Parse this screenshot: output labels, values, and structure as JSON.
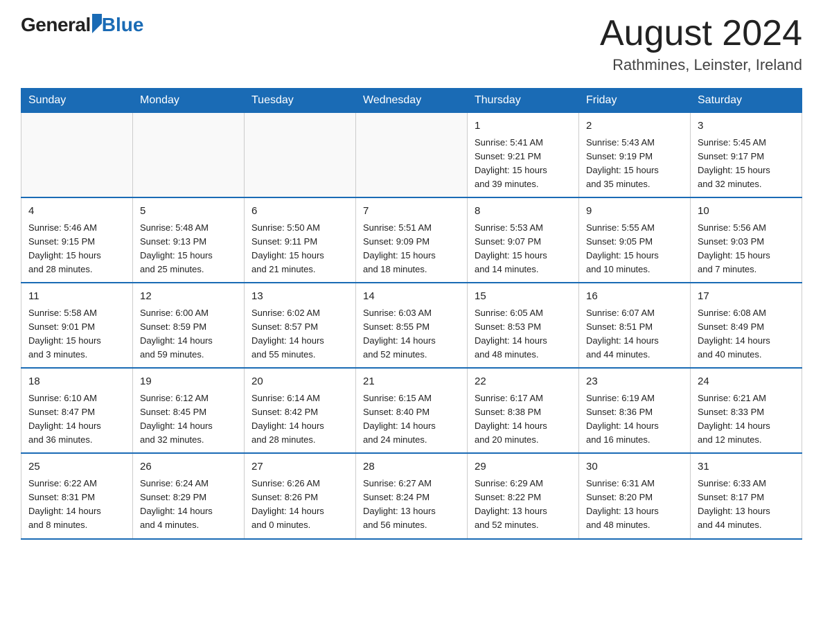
{
  "header": {
    "logo_general": "General",
    "logo_blue": "Blue",
    "month_title": "August 2024",
    "location": "Rathmines, Leinster, Ireland"
  },
  "days_of_week": [
    "Sunday",
    "Monday",
    "Tuesday",
    "Wednesday",
    "Thursday",
    "Friday",
    "Saturday"
  ],
  "weeks": [
    [
      {
        "day": "",
        "info": ""
      },
      {
        "day": "",
        "info": ""
      },
      {
        "day": "",
        "info": ""
      },
      {
        "day": "",
        "info": ""
      },
      {
        "day": "1",
        "info": "Sunrise: 5:41 AM\nSunset: 9:21 PM\nDaylight: 15 hours\nand 39 minutes."
      },
      {
        "day": "2",
        "info": "Sunrise: 5:43 AM\nSunset: 9:19 PM\nDaylight: 15 hours\nand 35 minutes."
      },
      {
        "day": "3",
        "info": "Sunrise: 5:45 AM\nSunset: 9:17 PM\nDaylight: 15 hours\nand 32 minutes."
      }
    ],
    [
      {
        "day": "4",
        "info": "Sunrise: 5:46 AM\nSunset: 9:15 PM\nDaylight: 15 hours\nand 28 minutes."
      },
      {
        "day": "5",
        "info": "Sunrise: 5:48 AM\nSunset: 9:13 PM\nDaylight: 15 hours\nand 25 minutes."
      },
      {
        "day": "6",
        "info": "Sunrise: 5:50 AM\nSunset: 9:11 PM\nDaylight: 15 hours\nand 21 minutes."
      },
      {
        "day": "7",
        "info": "Sunrise: 5:51 AM\nSunset: 9:09 PM\nDaylight: 15 hours\nand 18 minutes."
      },
      {
        "day": "8",
        "info": "Sunrise: 5:53 AM\nSunset: 9:07 PM\nDaylight: 15 hours\nand 14 minutes."
      },
      {
        "day": "9",
        "info": "Sunrise: 5:55 AM\nSunset: 9:05 PM\nDaylight: 15 hours\nand 10 minutes."
      },
      {
        "day": "10",
        "info": "Sunrise: 5:56 AM\nSunset: 9:03 PM\nDaylight: 15 hours\nand 7 minutes."
      }
    ],
    [
      {
        "day": "11",
        "info": "Sunrise: 5:58 AM\nSunset: 9:01 PM\nDaylight: 15 hours\nand 3 minutes."
      },
      {
        "day": "12",
        "info": "Sunrise: 6:00 AM\nSunset: 8:59 PM\nDaylight: 14 hours\nand 59 minutes."
      },
      {
        "day": "13",
        "info": "Sunrise: 6:02 AM\nSunset: 8:57 PM\nDaylight: 14 hours\nand 55 minutes."
      },
      {
        "day": "14",
        "info": "Sunrise: 6:03 AM\nSunset: 8:55 PM\nDaylight: 14 hours\nand 52 minutes."
      },
      {
        "day": "15",
        "info": "Sunrise: 6:05 AM\nSunset: 8:53 PM\nDaylight: 14 hours\nand 48 minutes."
      },
      {
        "day": "16",
        "info": "Sunrise: 6:07 AM\nSunset: 8:51 PM\nDaylight: 14 hours\nand 44 minutes."
      },
      {
        "day": "17",
        "info": "Sunrise: 6:08 AM\nSunset: 8:49 PM\nDaylight: 14 hours\nand 40 minutes."
      }
    ],
    [
      {
        "day": "18",
        "info": "Sunrise: 6:10 AM\nSunset: 8:47 PM\nDaylight: 14 hours\nand 36 minutes."
      },
      {
        "day": "19",
        "info": "Sunrise: 6:12 AM\nSunset: 8:45 PM\nDaylight: 14 hours\nand 32 minutes."
      },
      {
        "day": "20",
        "info": "Sunrise: 6:14 AM\nSunset: 8:42 PM\nDaylight: 14 hours\nand 28 minutes."
      },
      {
        "day": "21",
        "info": "Sunrise: 6:15 AM\nSunset: 8:40 PM\nDaylight: 14 hours\nand 24 minutes."
      },
      {
        "day": "22",
        "info": "Sunrise: 6:17 AM\nSunset: 8:38 PM\nDaylight: 14 hours\nand 20 minutes."
      },
      {
        "day": "23",
        "info": "Sunrise: 6:19 AM\nSunset: 8:36 PM\nDaylight: 14 hours\nand 16 minutes."
      },
      {
        "day": "24",
        "info": "Sunrise: 6:21 AM\nSunset: 8:33 PM\nDaylight: 14 hours\nand 12 minutes."
      }
    ],
    [
      {
        "day": "25",
        "info": "Sunrise: 6:22 AM\nSunset: 8:31 PM\nDaylight: 14 hours\nand 8 minutes."
      },
      {
        "day": "26",
        "info": "Sunrise: 6:24 AM\nSunset: 8:29 PM\nDaylight: 14 hours\nand 4 minutes."
      },
      {
        "day": "27",
        "info": "Sunrise: 6:26 AM\nSunset: 8:26 PM\nDaylight: 14 hours\nand 0 minutes."
      },
      {
        "day": "28",
        "info": "Sunrise: 6:27 AM\nSunset: 8:24 PM\nDaylight: 13 hours\nand 56 minutes."
      },
      {
        "day": "29",
        "info": "Sunrise: 6:29 AM\nSunset: 8:22 PM\nDaylight: 13 hours\nand 52 minutes."
      },
      {
        "day": "30",
        "info": "Sunrise: 6:31 AM\nSunset: 8:20 PM\nDaylight: 13 hours\nand 48 minutes."
      },
      {
        "day": "31",
        "info": "Sunrise: 6:33 AM\nSunset: 8:17 PM\nDaylight: 13 hours\nand 44 minutes."
      }
    ]
  ]
}
